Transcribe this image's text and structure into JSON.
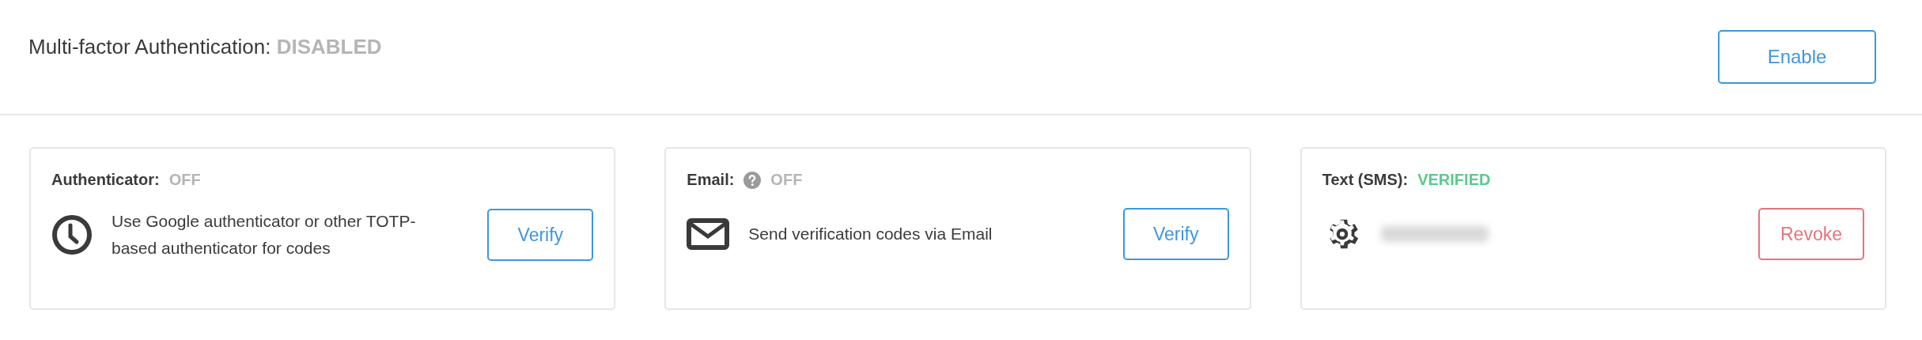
{
  "header": {
    "label": "Multi-factor Authentication:",
    "status": "DISABLED",
    "enabled": false,
    "button": {
      "label": "Enable"
    }
  },
  "methods": [
    {
      "kind": "authenticator",
      "label": "Authenticator:",
      "status": "OFF",
      "verified": false,
      "description": "Use Google authenticator or other TOTP-based authenticator for codes",
      "button": {
        "label": "Verify",
        "kind": "verify"
      }
    },
    {
      "kind": "email",
      "label": "Email:",
      "status": "OFF",
      "verified": false,
      "help": true,
      "description": "Send verification codes via Email",
      "button": {
        "label": "Verify",
        "kind": "verify"
      }
    },
    {
      "kind": "sms",
      "label": "Text (SMS):",
      "status": "VERIFIED",
      "verified": true,
      "redacted": true,
      "button": {
        "label": "Revoke",
        "kind": "revoke"
      }
    }
  ]
}
